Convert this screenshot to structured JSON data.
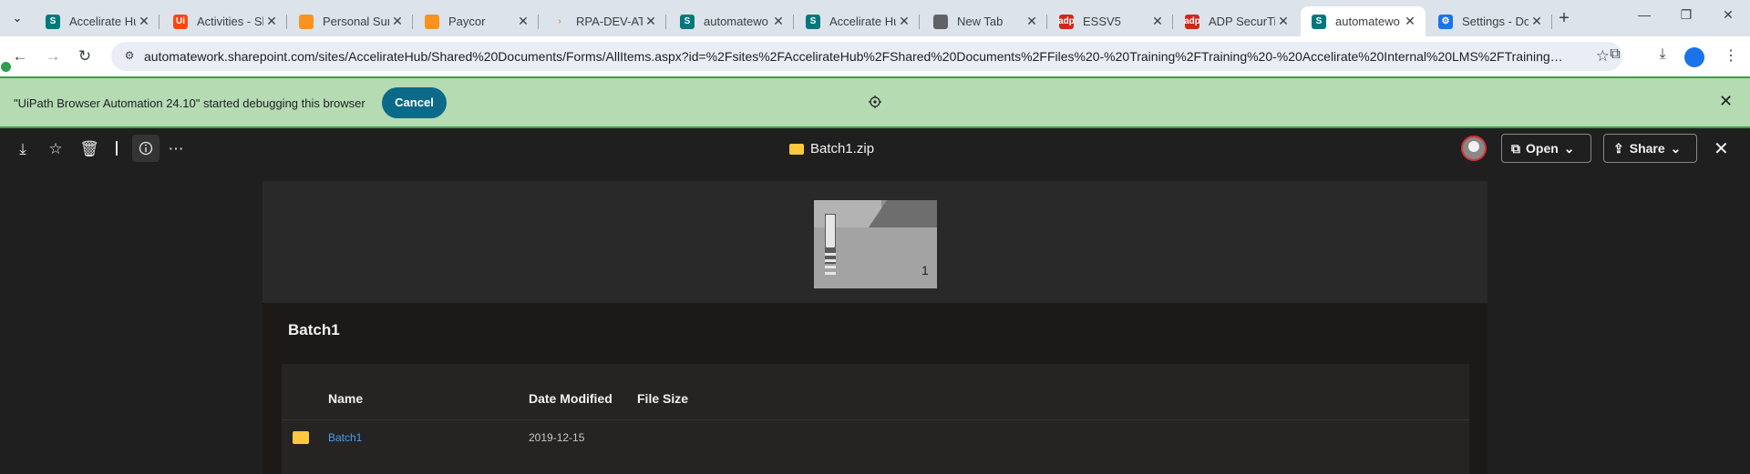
{
  "browser": {
    "tabs": [
      {
        "title": "Accelirate Hub",
        "fav_color": "#03787c",
        "fav_text": "S"
      },
      {
        "title": "Activities - Sh",
        "fav_color": "#fa4616",
        "fav_text": "Ui"
      },
      {
        "title": "Personal Sum",
        "fav_color": "#f7931e",
        "fav_text": ""
      },
      {
        "title": "Paycor",
        "fav_color": "#f7931e",
        "fav_text": ""
      },
      {
        "title": "RPA-DEV-AT",
        "fav_color": "#dde3ea",
        "fav_text": "›"
      },
      {
        "title": "automatewo",
        "fav_color": "#03787c",
        "fav_text": "S"
      },
      {
        "title": "Accelirate Hu",
        "fav_color": "#03787c",
        "fav_text": "S"
      },
      {
        "title": "New Tab",
        "fav_color": "#5f6368",
        "fav_text": ""
      },
      {
        "title": "ESSV5",
        "fav_color": "#d0271d",
        "fav_text": "adp"
      },
      {
        "title": "ADP SecurTi",
        "fav_color": "#d0271d",
        "fav_text": "adp"
      },
      {
        "title": "automatewo",
        "fav_color": "#03787c",
        "fav_text": "S"
      },
      {
        "title": "Settings - Do",
        "fav_color": "#1a73e8",
        "fav_text": "⚙"
      }
    ],
    "url": "automatework.sharepoint.com/sites/AccelirateHub/Shared%20Documents/Forms/AllItems.aspx?id=%2Fsites%2FAccelirateHub%2FShared%20Documents%2FFiles%20-%20Training%2FTraining%20-%20Accelirate%20Internal%20LMS%2FTraining%20-...",
    "tab_search_icon": "chevron-down-icon",
    "new_tab_icon": "plus-icon"
  },
  "debug_banner": {
    "message": "\"UiPath Browser Automation 24.10\" started debugging this browser",
    "cancel_label": "Cancel",
    "bg_color": "#b5dbb3"
  },
  "viewer": {
    "file_title": "Batch1.zip",
    "open_label": "Open",
    "share_label": "Share"
  },
  "preview": {
    "folder_count": "1",
    "list_title": "Batch1",
    "columns": [
      "Name",
      "Date Modified",
      "File Size"
    ],
    "rows": [
      {
        "name": "Batch1",
        "date_modified": "2019-12-15",
        "file_size": ""
      }
    ]
  }
}
